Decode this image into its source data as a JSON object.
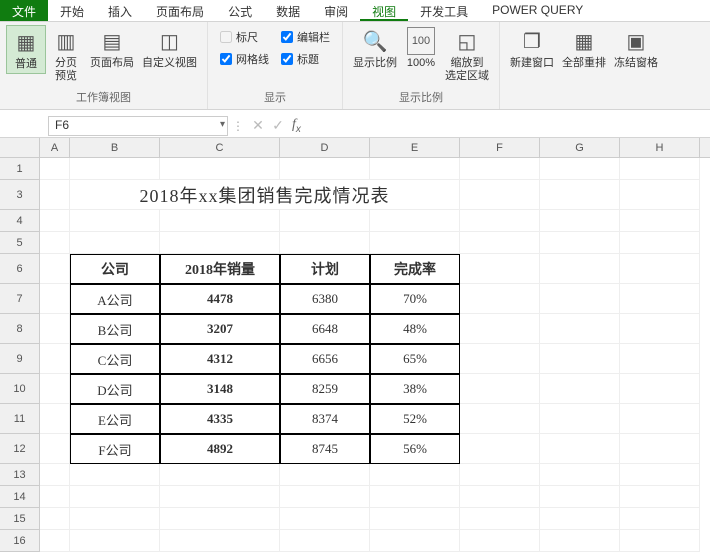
{
  "ribbon": {
    "tabs": [
      "文件",
      "开始",
      "插入",
      "页面布局",
      "公式",
      "数据",
      "审阅",
      "视图",
      "开发工具",
      "POWER QUERY"
    ],
    "active_tab_index": 7,
    "group_views": {
      "label": "工作簿视图",
      "normal": "普通",
      "page_break": "分页\n预览",
      "page_layout": "页面布局",
      "custom": "自定义视图"
    },
    "group_show": {
      "label": "显示",
      "ruler": "标尺",
      "formula_bar": "编辑栏",
      "gridlines": "网格线",
      "headings": "标题",
      "ruler_checked": false,
      "formula_bar_checked": true,
      "gridlines_checked": true,
      "headings_checked": true
    },
    "group_zoom": {
      "label": "显示比例",
      "zoom": "显示比例",
      "hundred": "100%",
      "to_selection": "缩放到\n选定区域"
    },
    "group_window": {
      "new_window": "新建窗口",
      "arrange_all": "全部重排",
      "freeze": "冻结窗格"
    }
  },
  "namebox": {
    "value": "F6"
  },
  "sheet": {
    "cols": [
      "A",
      "B",
      "C",
      "D",
      "E",
      "F",
      "G",
      "H"
    ],
    "row_numbers": [
      "1",
      "3",
      "4",
      "5",
      "6",
      "7",
      "8",
      "9",
      "10",
      "11",
      "12",
      "13",
      "14",
      "15",
      "16"
    ],
    "title": "2018年xx集团销售完成情况表",
    "headers": {
      "company": "公司",
      "sales": "2018年销量",
      "plan": "计划",
      "rate": "完成率"
    },
    "rows": [
      {
        "company": "A公司",
        "sales": "4478",
        "plan": "6380",
        "rate": "70%"
      },
      {
        "company": "B公司",
        "sales": "3207",
        "plan": "6648",
        "rate": "48%"
      },
      {
        "company": "C公司",
        "sales": "4312",
        "plan": "6656",
        "rate": "65%"
      },
      {
        "company": "D公司",
        "sales": "3148",
        "plan": "8259",
        "rate": "38%"
      },
      {
        "company": "E公司",
        "sales": "4335",
        "plan": "8374",
        "rate": "52%"
      },
      {
        "company": "F公司",
        "sales": "4892",
        "plan": "8745",
        "rate": "56%"
      }
    ]
  },
  "chart_data": {
    "type": "table",
    "title": "2018年xx集团销售完成情况表",
    "columns": [
      "公司",
      "2018年销量",
      "计划",
      "完成率"
    ],
    "rows": [
      [
        "A公司",
        4478,
        6380,
        "70%"
      ],
      [
        "B公司",
        3207,
        6648,
        "48%"
      ],
      [
        "C公司",
        4312,
        6656,
        "65%"
      ],
      [
        "D公司",
        3148,
        8259,
        "38%"
      ],
      [
        "E公司",
        4335,
        8374,
        "52%"
      ],
      [
        "F公司",
        4892,
        8745,
        "56%"
      ]
    ]
  }
}
